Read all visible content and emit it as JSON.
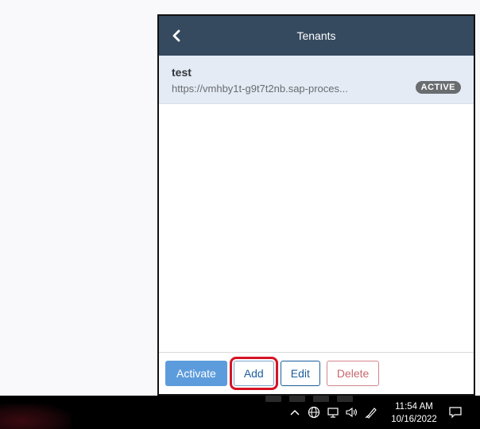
{
  "header": {
    "title": "Tenants"
  },
  "tenants": [
    {
      "name": "test",
      "url": "https://vmhby1t-g9t7t2nb.sap-proces...",
      "status": "ACTIVE"
    }
  ],
  "footer": {
    "activate_label": "Activate",
    "add_label": "Add",
    "edit_label": "Edit",
    "delete_label": "Delete"
  },
  "taskbar": {
    "time": "11:54 AM",
    "date": "10/16/2022",
    "tray_icons": [
      "chevron-up-icon",
      "network-globe-icon",
      "monitor-icon",
      "speaker-icon",
      "pen-icon"
    ]
  },
  "colors": {
    "header_bg": "#354a5f",
    "selected_row_bg": "#e4ebf5",
    "activate_bg": "#5d9cdc",
    "highlight": "#d41424"
  }
}
